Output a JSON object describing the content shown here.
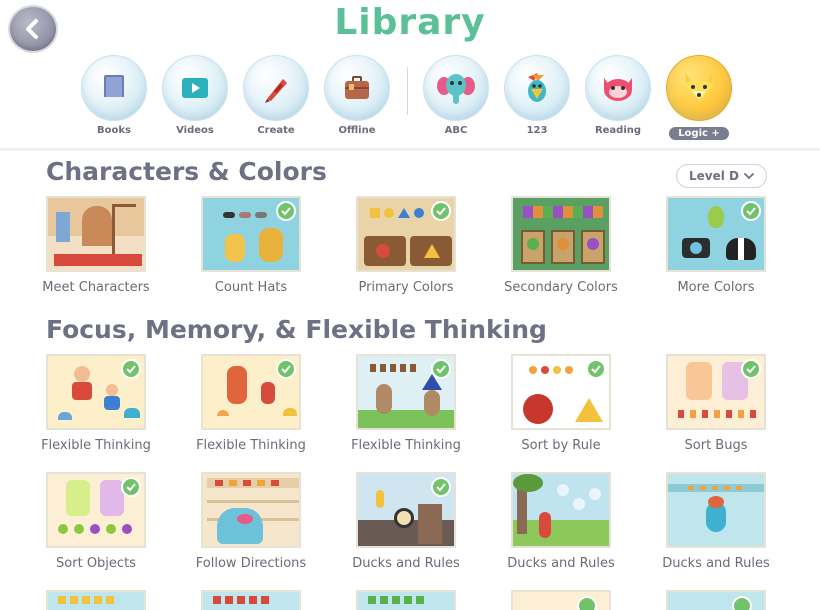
{
  "header": {
    "title": "Library",
    "back_icon": "chevron-left-icon"
  },
  "nav": {
    "items": [
      {
        "label": "Books",
        "icon": "book-icon"
      },
      {
        "label": "Videos",
        "icon": "play-icon"
      },
      {
        "label": "Create",
        "icon": "crayon-icon"
      },
      {
        "label": "Offline",
        "icon": "suitcase-icon"
      },
      {
        "label": "ABC",
        "icon": "elephant-icon"
      },
      {
        "label": "123",
        "icon": "bird-icon"
      },
      {
        "label": "Reading",
        "icon": "cat-icon"
      },
      {
        "label": "Logic +",
        "icon": "fox-icon",
        "active": true
      }
    ]
  },
  "sections": [
    {
      "title": "Characters & Colors",
      "level": "Level D",
      "cards": [
        {
          "label": "Meet Characters",
          "completed": false
        },
        {
          "label": "Count Hats",
          "completed": true
        },
        {
          "label": "Primary Colors",
          "completed": true
        },
        {
          "label": "Secondary Colors",
          "completed": false
        },
        {
          "label": "More Colors",
          "completed": true
        }
      ]
    },
    {
      "title": "Focus, Memory, & Flexible Thinking",
      "cards": [
        {
          "label": "Flexible Thinking",
          "completed": true
        },
        {
          "label": "Flexible Thinking",
          "completed": true
        },
        {
          "label": "Flexible Thinking",
          "completed": true
        },
        {
          "label": "Sort by Rule",
          "completed": true
        },
        {
          "label": "Sort Bugs",
          "completed": true
        },
        {
          "label": "Sort Objects",
          "completed": true
        },
        {
          "label": "Follow Directions",
          "completed": false
        },
        {
          "label": "Ducks and Rules",
          "completed": true
        },
        {
          "label": "Ducks and Rules",
          "completed": false
        },
        {
          "label": "Ducks and Rules",
          "completed": false
        }
      ]
    }
  ],
  "colors": {
    "accent": "#5bbf98",
    "check": "#70c26b",
    "active_tab": "#ffcc44"
  }
}
